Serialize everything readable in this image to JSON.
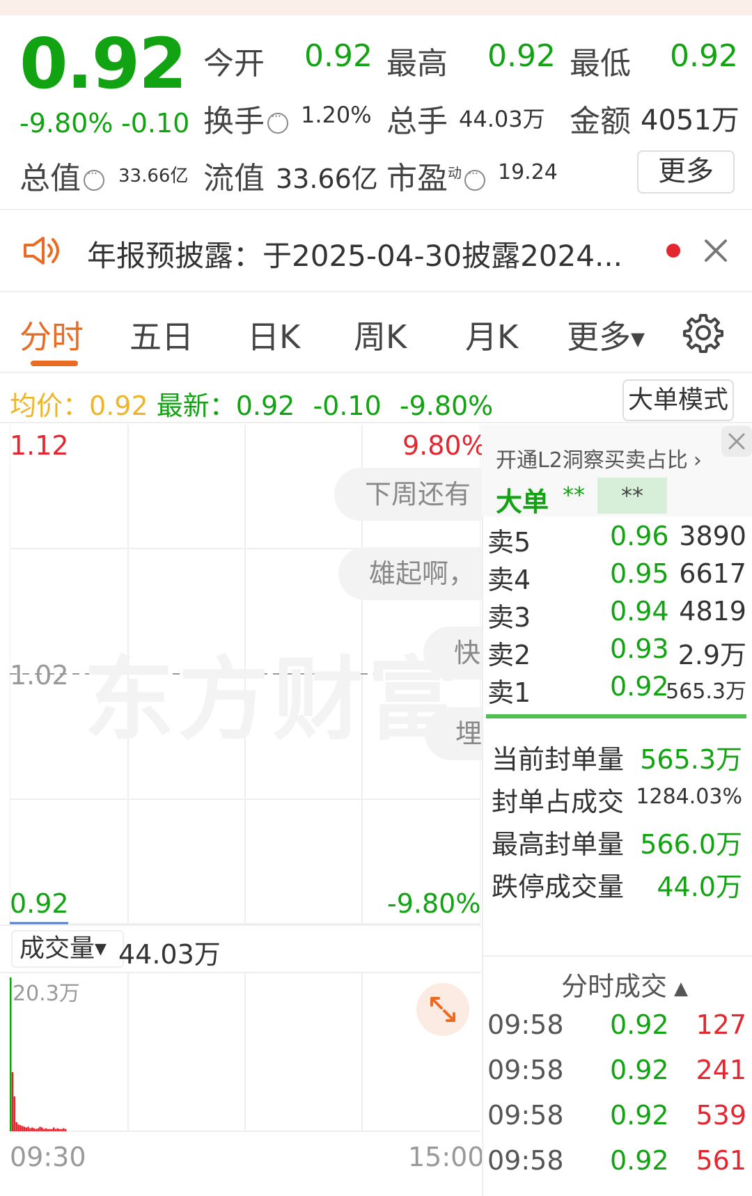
{
  "quote": {
    "price": "0.92",
    "change_pct": "-9.80%",
    "change": "-0.10",
    "open_label": "今开",
    "open": "0.92",
    "high_label": "最高",
    "high": "0.92",
    "low_label": "最低",
    "low": "0.92",
    "turnover_label": "换手",
    "turnover": "1.20%",
    "volume_label": "总手",
    "volume": "44.03万",
    "amount_label": "金额",
    "amount": "4051万",
    "mktcap_label": "总值",
    "mktcap": "33.66亿",
    "float_label": "流值",
    "float": "33.66亿",
    "pe_label": "市盈",
    "pe_sup": "动",
    "pe": "19.24",
    "more": "更多"
  },
  "notice": {
    "text": "年报预披露：于2025-04-30披露2024..."
  },
  "tabs": {
    "items": [
      "分时",
      "五日",
      "日K",
      "周K",
      "月K",
      "更多"
    ],
    "active": 0
  },
  "avg_line": {
    "avg_label": "均价：",
    "avg": "0.92",
    "latest_label": "最新：",
    "latest": "0.92",
    "change": "-0.10",
    "change_pct": "-9.80%",
    "big_order_btn": "大单模式"
  },
  "chart": {
    "y_top": "1.12",
    "y_mid": "1.02",
    "y_bottom": "0.92",
    "pct_top": "9.80%",
    "pct_bottom": "-9.80%",
    "comments": [
      "下周还有",
      "雄起啊，",
      "快",
      "埋"
    ],
    "watermark": "东方财富",
    "volume_label": "成交量",
    "volume_value": "44.03万",
    "vol_max": "20.3万",
    "time_start": "09:30",
    "time_end": "15:00"
  },
  "chart_data": {
    "type": "bar",
    "series": [
      {
        "name": "成交量",
        "x": [
          "09:30",
          "09:31",
          "09:32",
          "09:33",
          "09:34",
          "09:35",
          "09:36",
          "09:37",
          "09:38",
          "09:39",
          "09:40",
          "09:41",
          "09:42",
          "09:43",
          "09:44",
          "09:45",
          "09:46",
          "09:47",
          "09:48",
          "09:49",
          "09:50",
          "09:51",
          "09:52",
          "09:53",
          "09:54",
          "09:55",
          "09:56",
          "09:57",
          "09:58"
        ],
        "values": [
          20.3,
          7.8,
          4.6,
          1.2,
          0.9,
          0.8,
          0.7,
          0.6,
          0.5,
          0.6,
          0.4,
          0.5,
          0.4,
          0.3,
          0.4,
          0.6,
          0.5,
          0.3,
          0.4,
          0.3,
          0.3,
          0.3,
          0.5,
          0.3,
          0.4,
          0.3,
          0.3,
          0.4,
          0.3
        ]
      }
    ],
    "ylim": [
      0,
      20.3
    ],
    "xlabel": "",
    "ylabel": ""
  },
  "l2": {
    "title": "开通L2洞察买卖占比",
    "big_label": "大单",
    "big_a": "**",
    "big_b": "**"
  },
  "orderbook": [
    {
      "label": "卖5",
      "price": "0.96",
      "vol": "3890"
    },
    {
      "label": "卖4",
      "price": "0.95",
      "vol": "6617"
    },
    {
      "label": "卖3",
      "price": "0.94",
      "vol": "4819"
    },
    {
      "label": "卖2",
      "price": "0.93",
      "vol": "2.9万"
    },
    {
      "label": "卖1",
      "price": "0.92",
      "vol": "565.3万"
    }
  ],
  "seal": [
    {
      "label": "当前封单量",
      "value": "565.3万"
    },
    {
      "label": "封单占成交",
      "value": "1284.03%"
    },
    {
      "label": "最高封单量",
      "value": "566.0万"
    },
    {
      "label": "跌停成交量",
      "value": "44.0万"
    }
  ],
  "ticks": {
    "title": "分时成交",
    "rows": [
      {
        "time": "09:58",
        "price": "0.92",
        "vol": "127"
      },
      {
        "time": "09:58",
        "price": "0.92",
        "vol": "241"
      },
      {
        "time": "09:58",
        "price": "0.92",
        "vol": "539"
      },
      {
        "time": "09:58",
        "price": "0.92",
        "vol": "561"
      }
    ]
  },
  "colors": {
    "down": "#12a312",
    "up": "#e3262f",
    "accent": "#e96b24",
    "avg": "#f0b429"
  }
}
